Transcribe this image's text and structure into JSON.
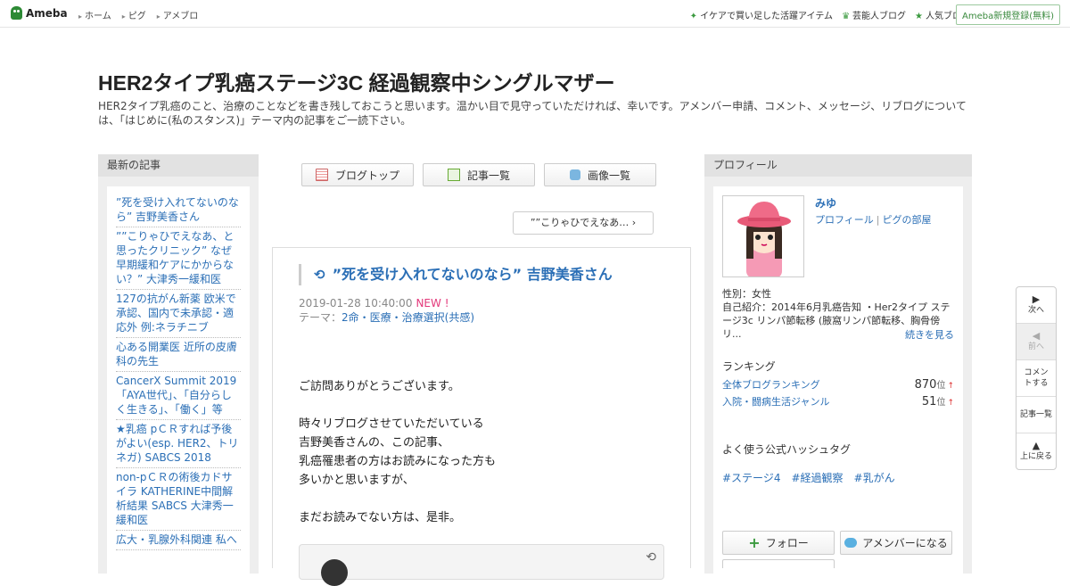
{
  "topbar": {
    "logo": "Ameba",
    "nav": [
      "ホーム",
      "ピグ",
      "アメブロ"
    ],
    "right_links": [
      {
        "icon": "sparkle-icon",
        "label": "イケアで買い足した活躍アイテム"
      },
      {
        "icon": "crown-icon",
        "label": "芸能人ブログ"
      },
      {
        "icon": "star-icon",
        "label": "人気ブログ"
      }
    ],
    "register": "Ameba新規登録(無料)"
  },
  "header": {
    "title": "HER2タイプ乳癌ステージ3C 経過観察中シングルマザー",
    "description": "HER2タイプ乳癌のこと、治療のことなどを書き残しておこうと思います。温かい目で見守っていただければ、幸いです。アメンバー申請、コメント、メッセージ、リブログについては、「はじめに(私のスタンス)」テーマ内の記事をご一読下さい。"
  },
  "left_sidebar": {
    "heading": "最新の記事",
    "articles": [
      "”死を受け入れてないのなら” 吉野美香さん",
      "””こりゃひでえなあ、と思ったクリニック” なぜ早期緩和ケアにかからない？” 大津秀一緩和医",
      "127の抗がん新薬 欧米で承認、国内で未承認・適応外 例:ネラチニブ",
      "心ある開業医 近所の皮膚科の先生",
      "CancerX Summit 2019 「AYA世代」、「自分らしく生きる」、「働く」等",
      "★乳癌 pＣＲすれば予後がよい(esp. HER2、トリネガ) SABCS 2018",
      "non-pＣＲの術後カドサイラ KATHERINE中間解析結果 SABCS 大津秀一緩和医",
      "広大・乳腺外科関連 私へ"
    ]
  },
  "center": {
    "nav_buttons": [
      {
        "icon": "document-icon",
        "label": "ブログトップ"
      },
      {
        "icon": "list-icon",
        "label": "記事一覧"
      },
      {
        "icon": "camera-icon",
        "label": "画像一覧"
      }
    ],
    "prev_link": "””こりゃひでえなあ…",
    "article": {
      "title": "”死を受け入れてないのなら” 吉野美香さん",
      "date": "2019-01-28 10:40:00",
      "new_badge": "NEW !",
      "theme_label": "テーマ：",
      "theme": "2命・医療・治療選択(共感)",
      "paragraphs": [
        [
          "ご訪問ありがとうございます。"
        ],
        [
          "時々リブログさせていただいている",
          "吉野美香さんの、この記事、",
          "乳癌罹患者の方はお読みになった方も",
          "多いかと思いますが、"
        ],
        [
          "まだお読みでない方は、是非。"
        ]
      ]
    }
  },
  "right_sidebar": {
    "heading": "プロフィール",
    "name": "みゆ",
    "link_profile": "プロフィール",
    "link_room": "ピグの部屋",
    "gender": "性別：女性",
    "intro": "自己紹介：2014年6月乳癌告知 ・Her2タイプ ステージ3c リンパ節転移 (腋窩リンパ節転移、胸骨傍リ...",
    "more": "続きを見る",
    "ranking_heading": "ランキング",
    "rankings": [
      {
        "label": "全体ブログランキング",
        "value": "870",
        "unit": "位",
        "trend": "↑"
      },
      {
        "label": "入院・闘病生活ジャンル",
        "value": "51",
        "unit": "位",
        "trend": "↑"
      }
    ],
    "tags_heading": "よく使う公式ハッシュタグ",
    "tags": [
      "#ステージ4",
      "#経過観察",
      "#乳がん"
    ],
    "follow": "フォロー",
    "amember": "アメンバーになる"
  },
  "side_tools": [
    {
      "icon": "play-right-icon",
      "glyph": "▶",
      "label": "次へ",
      "disabled": false
    },
    {
      "icon": "play-left-icon",
      "glyph": "◀",
      "label": "前へ",
      "disabled": true
    },
    {
      "icon": "",
      "glyph": "",
      "label": "コメントする",
      "disabled": false
    },
    {
      "icon": "",
      "glyph": "",
      "label": "記事一覧",
      "disabled": false
    },
    {
      "icon": "up-triangle-icon",
      "glyph": "▲",
      "label": "上に戻る",
      "disabled": false
    }
  ]
}
